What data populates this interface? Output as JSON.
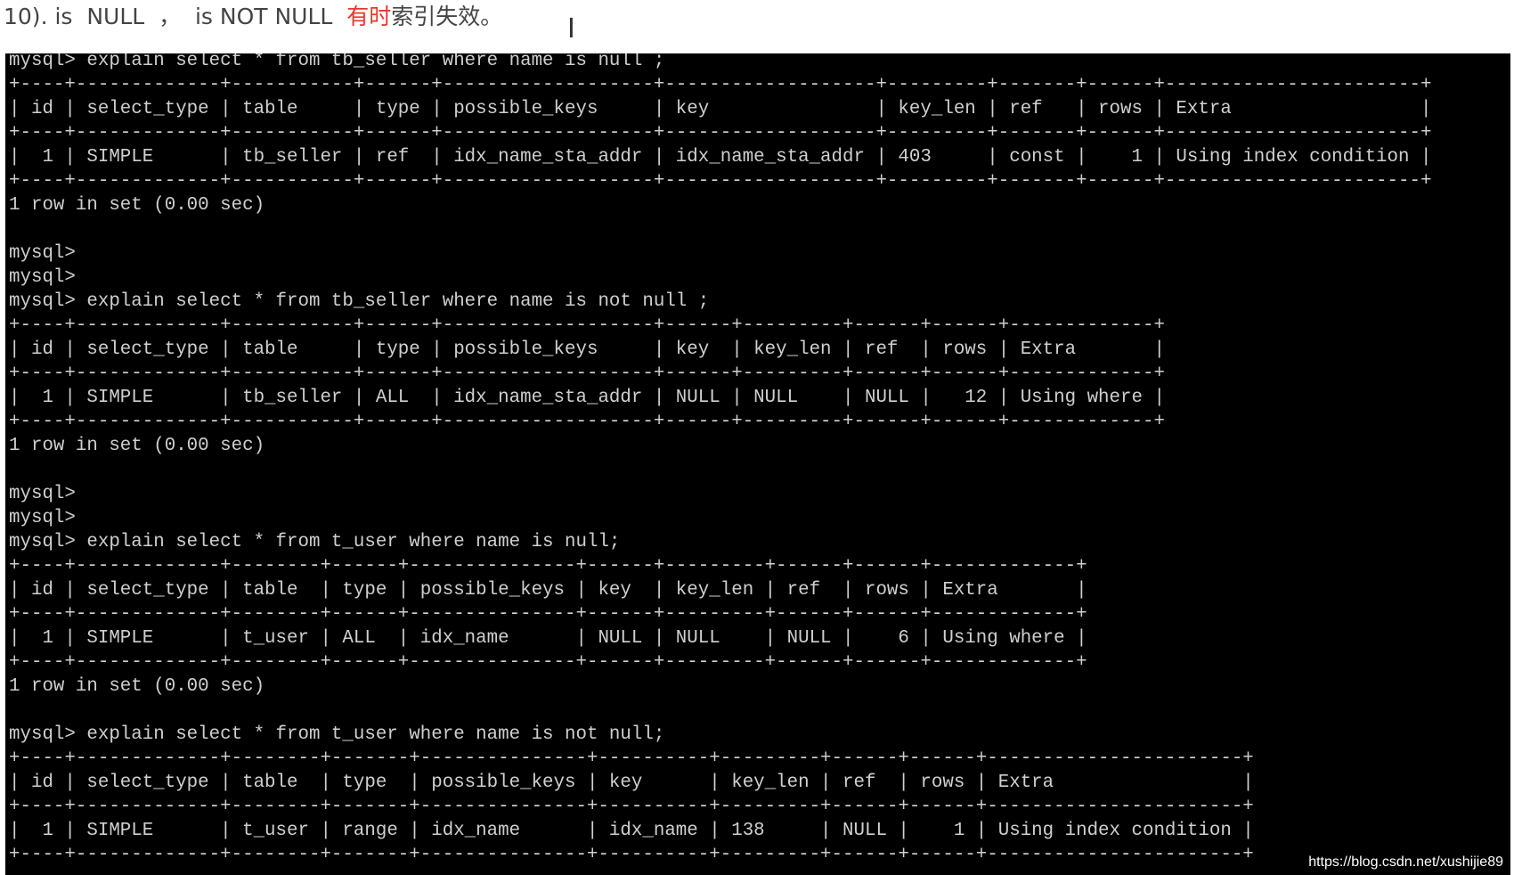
{
  "heading": {
    "prefix": "10). is  NULL  ，  is NOT NULL  ",
    "highlight": "有时",
    "suffix": "索引失效。"
  },
  "cursor_glyph": "I",
  "terminal": {
    "lines": [
      "mysql> explain select * from tb_seller where name is null ;",
      "+----+-------------+-----------+------+-------------------+-------------------+---------+-------+------+-----------------------+",
      "| id | select_type | table     | type | possible_keys     | key               | key_len | ref   | rows | Extra                 |",
      "+----+-------------+-----------+------+-------------------+-------------------+---------+-------+------+-----------------------+",
      "|  1 | SIMPLE      | tb_seller | ref  | idx_name_sta_addr | idx_name_sta_addr | 403     | const |    1 | Using index condition |",
      "+----+-------------+-----------+------+-------------------+-------------------+---------+-------+------+-----------------------+",
      "1 row in set (0.00 sec)",
      "",
      "mysql>",
      "mysql>",
      "mysql> explain select * from tb_seller where name is not null ;",
      "+----+-------------+-----------+------+-------------------+------+---------+------+------+-------------+",
      "| id | select_type | table     | type | possible_keys     | key  | key_len | ref  | rows | Extra       |",
      "+----+-------------+-----------+------+-------------------+------+---------+------+------+-------------+",
      "|  1 | SIMPLE      | tb_seller | ALL  | idx_name_sta_addr | NULL | NULL    | NULL |   12 | Using where |",
      "+----+-------------+-----------+------+-------------------+------+---------+------+------+-------------+",
      "1 row in set (0.00 sec)",
      "",
      "mysql>",
      "mysql>",
      "mysql> explain select * from t_user where name is null;",
      "+----+-------------+--------+------+---------------+------+---------+------+------+-------------+",
      "| id | select_type | table  | type | possible_keys | key  | key_len | ref  | rows | Extra       |",
      "+----+-------------+--------+------+---------------+------+---------+------+------+-------------+",
      "|  1 | SIMPLE      | t_user | ALL  | idx_name      | NULL | NULL    | NULL |    6 | Using where |",
      "+----+-------------+--------+------+---------------+------+---------+------+------+-------------+",
      "1 row in set (0.00 sec)",
      "",
      "mysql> explain select * from t_user where name is not null;",
      "+----+-------------+--------+-------+---------------+----------+---------+------+------+-----------------------+",
      "| id | select_type | table  | type  | possible_keys | key      | key_len | ref  | rows | Extra                 |",
      "+----+-------------+--------+-------+---------------+----------+---------+------+------+-----------------------+",
      "|  1 | SIMPLE      | t_user | range | idx_name      | idx_name | 138     | NULL |    1 | Using index condition |",
      "+----+-------------+--------+-------+---------------+----------+---------+------+------+-----------------------+"
    ]
  },
  "watermark": "https://blog.csdn.net/xushijie89",
  "colors": {
    "highlight": "#e8372e",
    "terminal_bg": "#000000",
    "terminal_text": "#cfcfcf"
  }
}
